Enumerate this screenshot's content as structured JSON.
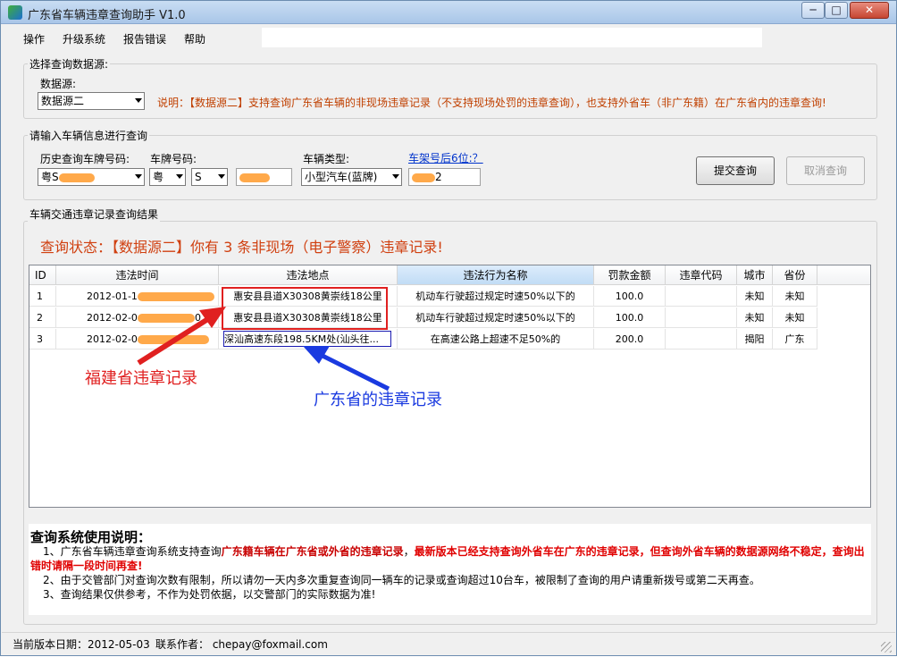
{
  "window": {
    "title": "广东省车辆违章查询助手 V1.0",
    "min_label": "─",
    "max_label": "□",
    "close_label": "✕"
  },
  "menu": [
    "操作",
    "升级系统",
    "报告错误",
    "帮助"
  ],
  "source_group": {
    "title": "选择查询数据源:",
    "label": "数据源:",
    "value": "数据源二",
    "note": "说明：【数据源二】支持查询广东省车辆的非现场违章记录（不支持现场处罚的违章查询），也支持外省车（非广东籍）在广东省内的违章查询!"
  },
  "vehicle_group": {
    "title": "请输入车辆信息进行查询",
    "history_label": "历史查询车牌号码:",
    "history_value": "粤S",
    "plate_label": "车牌号码:",
    "province_value": "粤",
    "letter_value": "S",
    "type_label": "车辆类型:",
    "type_value": "小型汽车(蓝牌)",
    "vin_label": "车架号后6位:？",
    "vin_value": "2",
    "submit": "提交查询",
    "cancel": "取消查询"
  },
  "result_group": {
    "title": "车辆交通违章记录查询结果",
    "status": "查询状态：【数据源二】你有 3 条非现场（电子警察）违章记录!"
  },
  "table": {
    "columns": [
      "ID",
      "违法时间",
      "违法地点",
      "违法行为名称",
      "罚款金额",
      "违章代码",
      "城市",
      "省份"
    ],
    "rows": [
      {
        "id": "1",
        "time": "2012-01-1",
        "place": "惠安县县道X30308黄崇线18公里",
        "behavior": "机动车行驶超过规定时速50%以下的",
        "fine": "100.0",
        "code": "",
        "city": "未知",
        "province": "未知"
      },
      {
        "id": "2",
        "time": "2012-02-0",
        "time_tail": "0",
        "place": "惠安县县道X30308黄崇线18公里",
        "behavior": "机动车行驶超过规定时速50%以下的",
        "fine": "100.0",
        "code": "",
        "city": "未知",
        "province": "未知"
      },
      {
        "id": "3",
        "time": "2012-02-0",
        "place": "深汕高速东段198.5KM处(汕头往...",
        "behavior": "在高速公路上超速不足50%的",
        "fine": "200.0",
        "code": "",
        "city": "揭阳",
        "province": "广东"
      }
    ]
  },
  "annotations": {
    "red": "福建省违章记录",
    "blue": "广东省的违章记录",
    "red_color": "#e02020",
    "blue_color": "#1a3ae0"
  },
  "help": {
    "title": "查询系统使用说明：",
    "line1_a": "1、广东省车辆违章查询系统支持查询",
    "line1_b": "广东籍车辆在广东省或外省的违章记录",
    "line1_c": "，",
    "line1_d": "最新版本已经支持查询外省车在广东的违章记录，但查询外省车辆的数据源网络不稳定，查询出错时请隔一段时间再查!",
    "line2": "2、由于交管部门对查询次数有限制，所以请勿一天内多次重复查询同一辆车的记录或查询超过10台车，被限制了查询的用户请重新拨号或第二天再查。",
    "line3": "3、查询结果仅供参考，不作为处罚依据，以交警部门的实际数据为准!"
  },
  "statusbar": {
    "version": "当前版本日期：2012-05-03",
    "contact": "联系作者： chepay@foxmail.com"
  }
}
